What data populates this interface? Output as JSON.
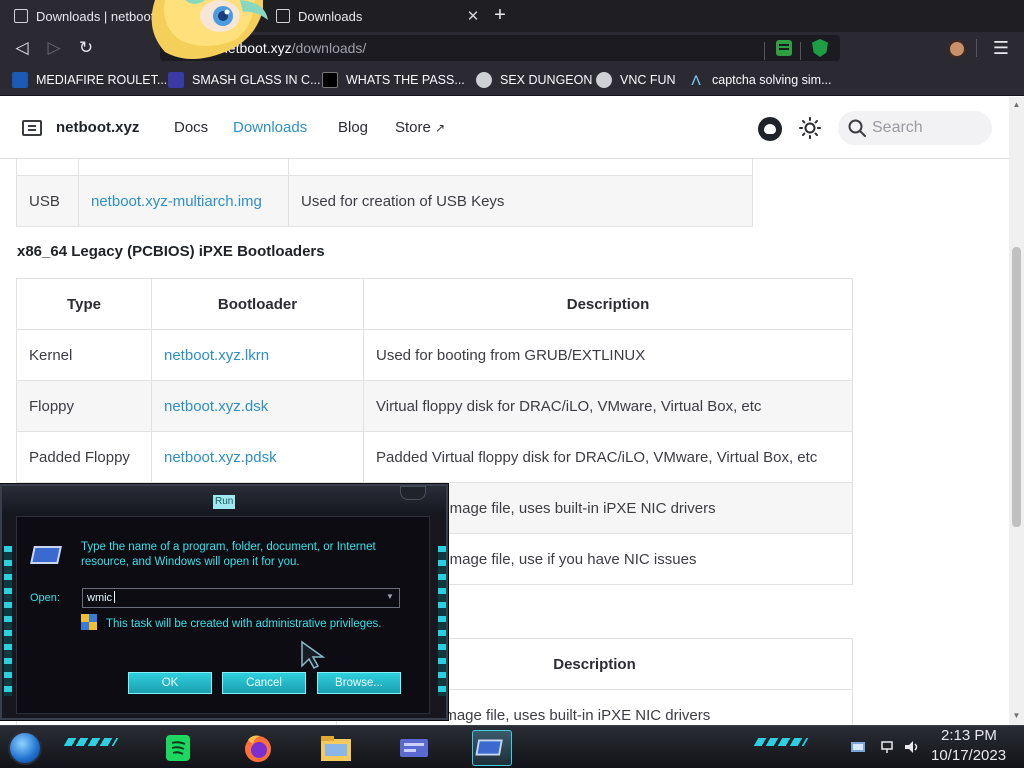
{
  "browser": {
    "tabs": [
      {
        "title": "Downloads | netboot",
        "active": true
      },
      {
        "title": "Downloads",
        "active": false
      }
    ],
    "url_host": "netboot.xyz",
    "url_path": "/downloads/",
    "bookmarks": [
      {
        "label": "MEDIAFIRE ROULET...",
        "icon": "mediafire-icon"
      },
      {
        "label": "SMASH GLASS IN C...",
        "icon": "glass-icon"
      },
      {
        "label": "WHATS THE PASS...",
        "icon": "password-icon"
      },
      {
        "label": "SEX DUNGEON",
        "icon": "dungeon-icon"
      },
      {
        "label": "VNC FUN",
        "icon": "vnc-icon"
      },
      {
        "label": "captcha solving sim...",
        "icon": "captcha-icon"
      }
    ]
  },
  "site": {
    "logo": "netboot.xyz",
    "nav": [
      {
        "label": "Docs",
        "active": false
      },
      {
        "label": "Downloads",
        "active": true
      },
      {
        "label": "Blog",
        "active": false
      },
      {
        "label": "Store",
        "active": false
      }
    ],
    "search_placeholder": "Search"
  },
  "content": {
    "usb_row": {
      "type": "USB",
      "file": "netboot.xyz-multiarch.img",
      "desc": "Used for creation of USB Keys"
    },
    "section_title": "x86_64 Legacy (PCBIOS) iPXE Bootloaders",
    "table_headers": [
      "Type",
      "Bootloader",
      "Description"
    ],
    "rows": [
      {
        "type": "Kernel",
        "file": "netboot.xyz.lkrn",
        "desc": "Used for booting from GRUB/EXTLINUX"
      },
      {
        "type": "Floppy",
        "file": "netboot.xyz.dsk",
        "desc": "Virtual floppy disk for DRAC/iLO, VMware, Virtual Box, etc"
      },
      {
        "type": "Padded Floppy",
        "file": "netboot.xyz.pdsk",
        "desc": "Padded Virtual floppy disk for DRAC/iLO, VMware, Virtual Box, etc"
      },
      {
        "type": "",
        "file": "",
        "desc": "t image file, uses built-in iPXE NIC drivers"
      },
      {
        "type": "",
        "file": "",
        "desc": "t image file, use if you have NIC issues"
      }
    ],
    "table2_header": "Description",
    "table2_partial_row": "image file, uses built-in iPXE NIC drivers"
  },
  "run_dialog": {
    "title": "Run",
    "description": "Type the name of a program, folder, document, or Internet resource, and Windows will open it for you.",
    "open_label": "Open:",
    "input_value": "wmic",
    "admin_note": "This task will be created with administrative privileges.",
    "ok": "OK",
    "cancel": "Cancel",
    "browse": "Browse..."
  },
  "taskbar": {
    "time": "2:13 PM",
    "date": "10/17/2023",
    "apps": [
      "spotify-icon",
      "firefox-icon",
      "file-explorer-icon",
      "control-panel-icon",
      "run-icon"
    ]
  },
  "colors": {
    "link": "#2f8fc6",
    "dialog_text": "#38e0ea",
    "browser_bg": "#2b2a33"
  }
}
